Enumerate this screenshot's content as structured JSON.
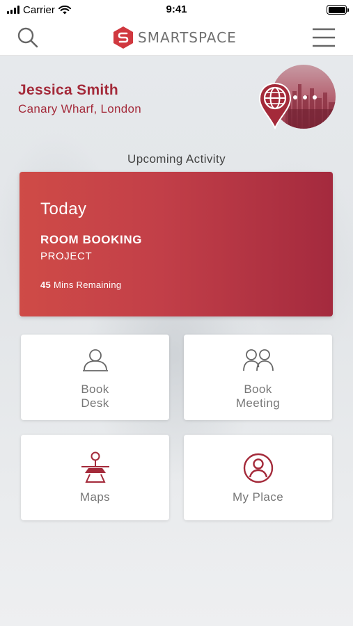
{
  "status_bar": {
    "carrier": "Carrier",
    "time": "9:41"
  },
  "nav": {
    "brand": "SMARTSPACE",
    "search_icon": "search-icon",
    "menu_icon": "hamburger-menu-icon"
  },
  "profile": {
    "name": "Jessica Smith",
    "location": "Canary Wharf, London"
  },
  "upcoming": {
    "title": "Upcoming Activity",
    "day": "Today",
    "type": "ROOM BOOKING",
    "subtitle": "PROJECT",
    "minutes": "45",
    "remaining_label": "Mins Remaining"
  },
  "tiles": [
    {
      "line1": "Book",
      "line2": "Desk",
      "icon": "person-icon"
    },
    {
      "line1": "Book",
      "line2": "Meeting",
      "icon": "people-icon"
    },
    {
      "line1": "Maps",
      "icon": "map-pin-icon"
    },
    {
      "line1": "My Place",
      "icon": "user-circle-icon"
    }
  ],
  "colors": {
    "brand": "#a42a3a",
    "card_start": "#cf4b47",
    "card_end": "#a42a3e",
    "tile_text": "#777777"
  }
}
